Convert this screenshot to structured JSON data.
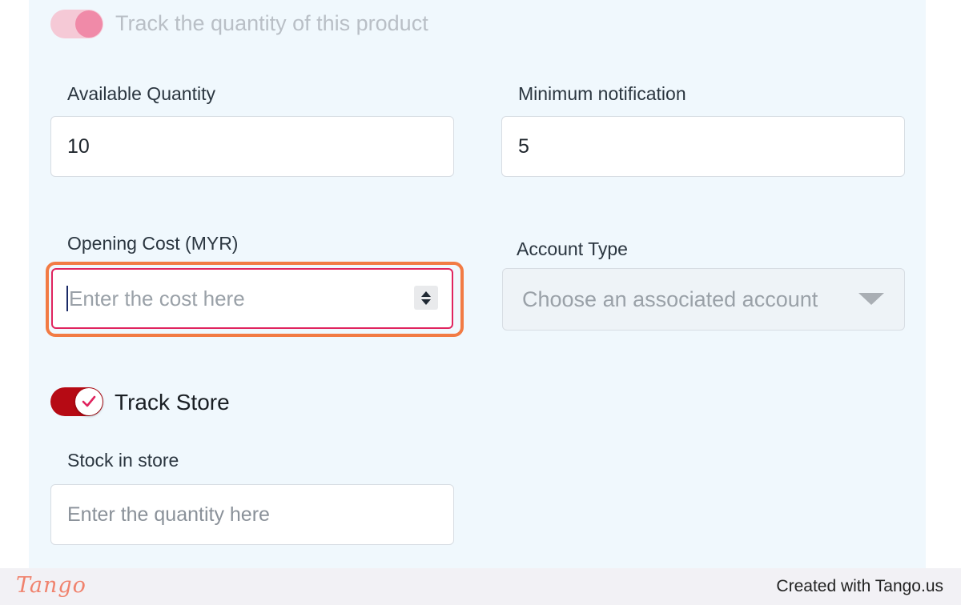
{
  "track_quantity": {
    "label": "Track the quantity of this product",
    "enabled": true
  },
  "available_quantity": {
    "label": "Available Quantity",
    "value": "10"
  },
  "minimum_notification": {
    "label": "Minimum notification",
    "value": "5"
  },
  "opening_cost": {
    "label": "Opening Cost (MYR)",
    "placeholder": "Enter the cost here",
    "value": ""
  },
  "account_type": {
    "label": "Account Type",
    "placeholder": "Choose an associated account"
  },
  "track_store": {
    "label": "Track Store",
    "checked": true
  },
  "stock_in_store": {
    "label": "Stock in store",
    "placeholder": "Enter the quantity here"
  },
  "footer": {
    "logo": "Tango",
    "credit": "Created with Tango.us"
  },
  "colors": {
    "panel_bg": "#f0f8fd",
    "accent_pink": "#e0245e",
    "toggle_on": "#b60a14",
    "focus_ring": "#f27b44",
    "tango_brand": "#f0826d"
  }
}
